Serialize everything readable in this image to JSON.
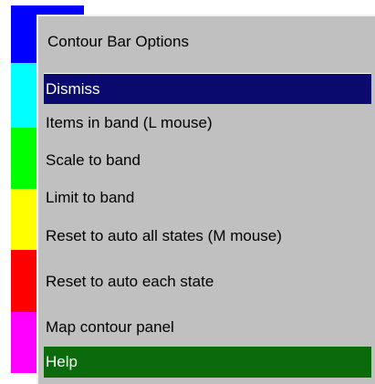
{
  "contour_bar": {
    "bands": [
      "#0000ff",
      "#00ffff",
      "#00ff00",
      "#ffff00",
      "#ff0000",
      "#ff00ff"
    ]
  },
  "menu": {
    "title": "Contour Bar Options",
    "items": [
      {
        "label": "Dismiss",
        "style": "dismiss",
        "bg": "#0a0a6e"
      },
      {
        "label": "Items in band (L mouse)"
      },
      {
        "label": "Scale to band"
      },
      {
        "label": "Limit to band"
      },
      {
        "label": "Reset to auto all states (M mouse)"
      },
      {
        "label": "Reset to auto each state"
      },
      {
        "label": "Map contour panel"
      },
      {
        "label": "Help",
        "style": "help",
        "bg": "#0b6a0b"
      }
    ]
  }
}
